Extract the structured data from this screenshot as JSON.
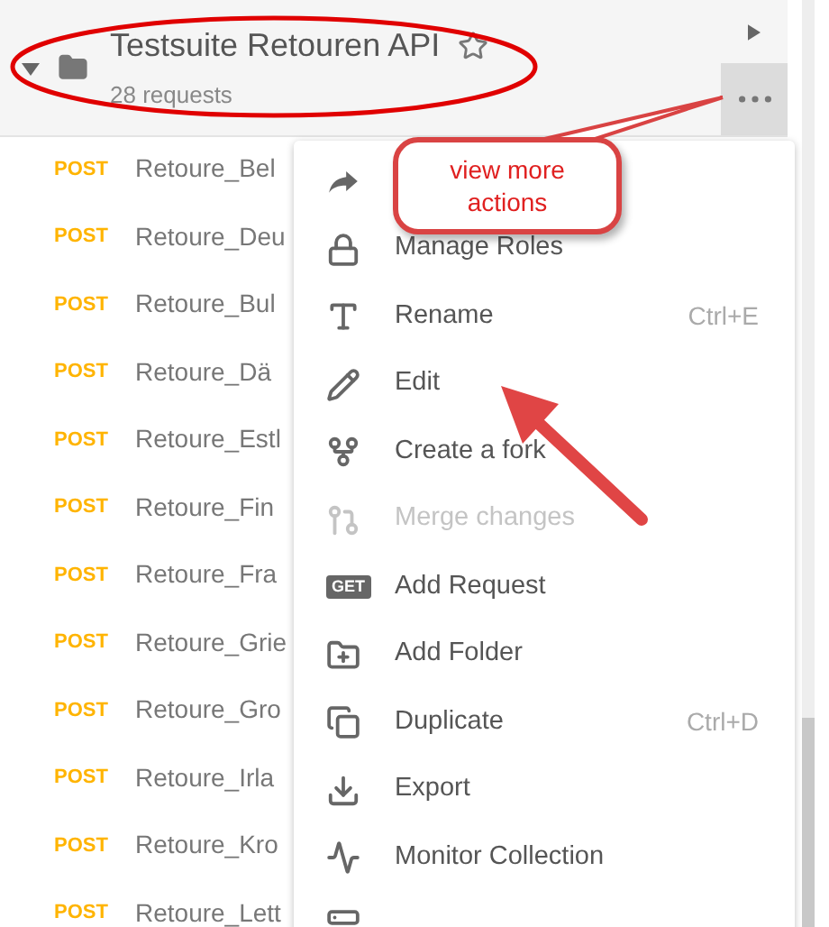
{
  "collection": {
    "title": "Testsuite Retouren API",
    "subtitle": "28 requests",
    "expanded": true
  },
  "requests": [
    {
      "method": "POST",
      "name": "Retoure_Bel"
    },
    {
      "method": "POST",
      "name": "Retoure_Deu"
    },
    {
      "method": "POST",
      "name": "Retoure_Bul"
    },
    {
      "method": "POST",
      "name": "Retoure_Dä"
    },
    {
      "method": "POST",
      "name": "Retoure_Estl"
    },
    {
      "method": "POST",
      "name": "Retoure_Fin"
    },
    {
      "method": "POST",
      "name": "Retoure_Fra"
    },
    {
      "method": "POST",
      "name": "Retoure_Grie"
    },
    {
      "method": "POST",
      "name": "Retoure_Gro"
    },
    {
      "method": "POST",
      "name": "Retoure_Irla"
    },
    {
      "method": "POST",
      "name": "Retoure_Kro"
    },
    {
      "method": "POST",
      "name": "Retoure_Lett"
    }
  ],
  "menu": {
    "items": [
      {
        "kind": "icon",
        "disabled": false
      },
      {
        "kind": "icon",
        "label": "Manage Roles",
        "disabled": false
      },
      {
        "kind": "icon",
        "label": "Rename",
        "shortcut": "Ctrl+E",
        "disabled": false
      },
      {
        "kind": "icon",
        "label": "Edit",
        "disabled": false
      },
      {
        "kind": "icon",
        "label": "Create a fork",
        "disabled": false
      },
      {
        "kind": "icon",
        "label": "Merge changes",
        "disabled": true
      },
      {
        "kind": "badge",
        "badge": "GET",
        "label": "Add Request",
        "disabled": false
      },
      {
        "kind": "icon",
        "label": "Add Folder",
        "disabled": false
      },
      {
        "kind": "icon",
        "label": "Duplicate",
        "shortcut": "Ctrl+D",
        "disabled": false
      },
      {
        "kind": "icon",
        "label": "Export",
        "disabled": false
      },
      {
        "kind": "icon",
        "label": "Monitor Collection",
        "disabled": false
      },
      {
        "kind": "icon",
        "disabled": false
      }
    ]
  },
  "callout": {
    "text": "view more actions"
  }
}
